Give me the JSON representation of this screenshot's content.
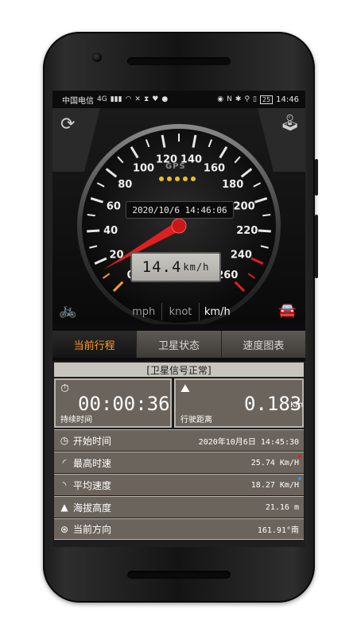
{
  "statusbar": {
    "carrier": "中国电信",
    "signal": "4G",
    "battery": "25",
    "time": "14:46"
  },
  "gauge": {
    "ticks": [
      "0",
      "20",
      "40",
      "60",
      "80",
      "100",
      "120",
      "140",
      "160",
      "180",
      "200",
      "220",
      "240",
      "260"
    ],
    "gps_label": "GPS",
    "datetime": "2020/10/6 14:46:06",
    "speed_value": "14.4",
    "speed_unit": "km/h",
    "needle_speed": 14.4,
    "units": [
      "mph",
      "knot",
      "km/h"
    ],
    "selected_unit": "km/h"
  },
  "colors": {
    "accent": "#ff9a1f",
    "needle": "#e02020",
    "card": "#6b645c",
    "gps_dot": "#e8c21a",
    "car": "#e6d81a"
  },
  "tabs": [
    {
      "label": "当前行程",
      "active": true
    },
    {
      "label": "卫星状态",
      "active": false
    },
    {
      "label": "速度图表",
      "active": false
    }
  ],
  "trip": {
    "signal_status": "[卫星信号正常]",
    "duration_value": "00:00:36",
    "duration_label": "持续时间",
    "distance_value": "0.183",
    "distance_unit": "Km",
    "distance_label": "行驶距离",
    "rows": [
      {
        "label": "开始时间",
        "value": "2020年10月6日 14:45:30",
        "icon": "clock-icon"
      },
      {
        "label": "最高时速",
        "value": "25.74 Km/H",
        "icon": "max-speed-icon",
        "dot": "#e02020"
      },
      {
        "label": "平均速度",
        "value": "18.27 Km/H",
        "icon": "avg-speed-icon",
        "dot": "#3a8ee0"
      },
      {
        "label": "海拔高度",
        "value": "21.16 m",
        "icon": "mountain-icon"
      },
      {
        "label": "当前方向",
        "value": "161.91°南",
        "icon": "compass-icon"
      }
    ]
  }
}
